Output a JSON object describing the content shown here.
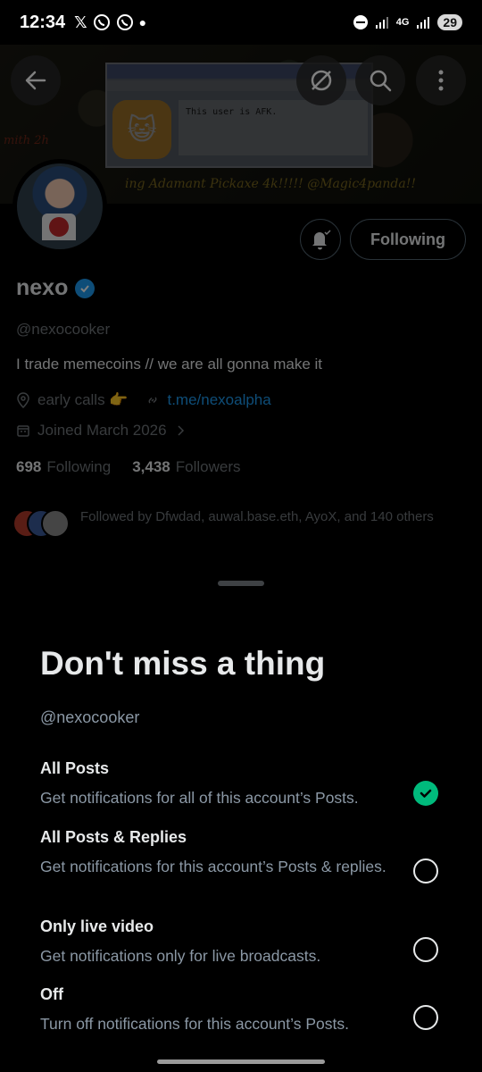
{
  "status_bar": {
    "time": "12:34",
    "left_icons": [
      "x-logo-icon",
      "whatsapp-icon",
      "whatsapp-icon",
      "dot-icon"
    ],
    "network": "4G",
    "battery": "29"
  },
  "banner": {
    "window_text": "This user is AFK.",
    "caption": "ing Adamant Pickaxe 4k!!!!! @Magic4panda!!",
    "left_text": "mith 2h"
  },
  "profile": {
    "name": "nexo",
    "handle": "@nexocooker",
    "bio": "I trade memecoins // we are all gonna make it",
    "location": "early calls 👉",
    "link": "t.me/nexoalpha",
    "joined": "Joined March 2026",
    "following_count": "698",
    "following_label": "Following",
    "followers_count": "3,438",
    "followers_label": "Followers",
    "followed_by": "Followed by Dfwdad, auwal.base.eth, AyoX, and 140 others",
    "following_button": "Following"
  },
  "sheet": {
    "title": "Don't miss a thing",
    "handle": "@nexocooker",
    "options": [
      {
        "title": "All Posts",
        "desc": "Get notifications for all of this account’s Posts.",
        "selected": true
      },
      {
        "title": "All Posts & Replies",
        "desc": "Get notifications for this account’s Posts & replies.",
        "selected": false
      },
      {
        "title": "Only live video",
        "desc": "Get notifications only for live broadcasts.",
        "selected": false
      },
      {
        "title": "Off",
        "desc": "Turn off notifications for this account’s Posts.",
        "selected": false
      }
    ]
  },
  "colors": {
    "accent": "#1d9bf0",
    "selected": "#00ba7c",
    "muted": "#71767b"
  }
}
